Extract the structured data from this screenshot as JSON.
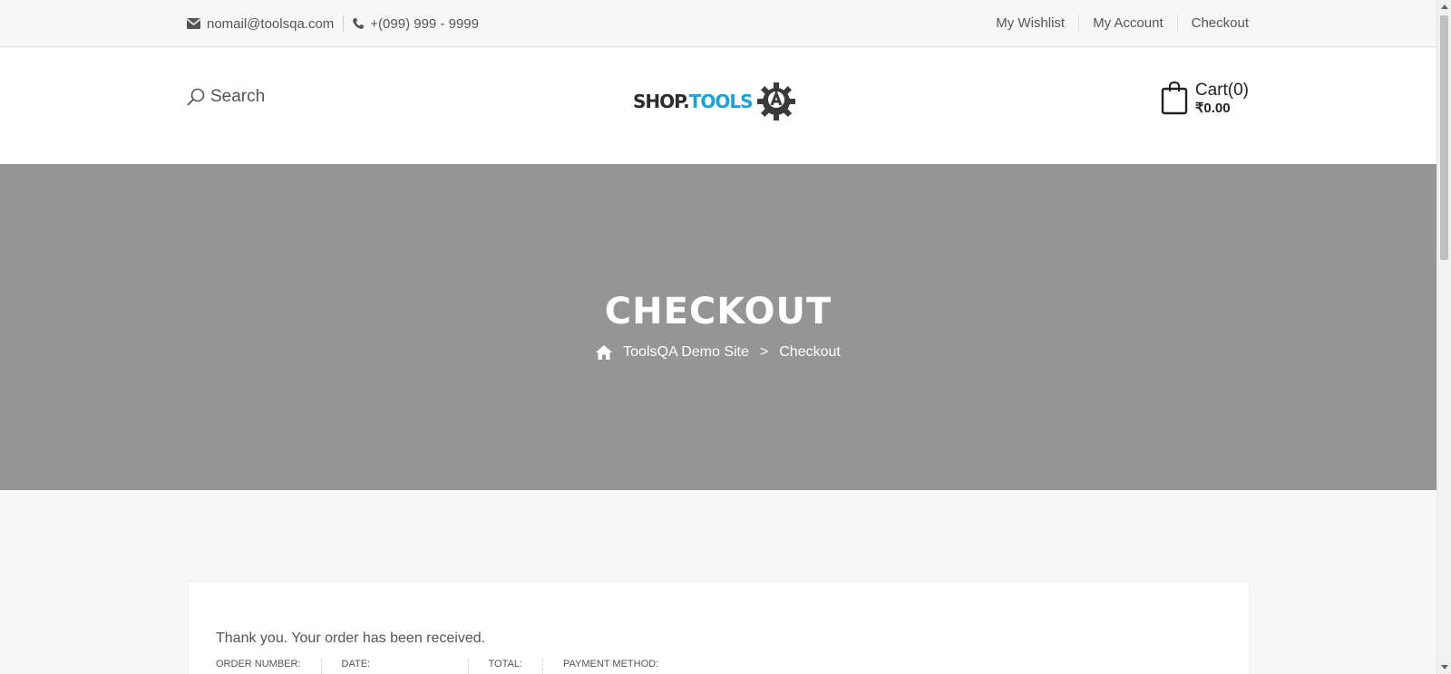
{
  "topbar": {
    "email": "nomail@toolsqa.com",
    "phone": "+(099) 999 - 9999",
    "links": [
      "My Wishlist",
      "My Account",
      "Checkout"
    ]
  },
  "header": {
    "search_label": "Search",
    "logo_text_a": "SHOP.",
    "logo_text_b": "TOOLS",
    "cart_label": "Cart(0)",
    "cart_total": "₹0.00"
  },
  "banner": {
    "title": "CHECKOUT",
    "breadcrumb_home": "ToolsQA Demo Site",
    "breadcrumb_sep": ">",
    "breadcrumb_current": "Checkout"
  },
  "order": {
    "thanks": "Thank you. Your order has been received.",
    "columns": [
      "Order number:",
      "Date:",
      "Total:",
      "Payment method:"
    ]
  },
  "colors": {
    "accent": "#1aa3d9",
    "banner_bg": "#959595"
  }
}
